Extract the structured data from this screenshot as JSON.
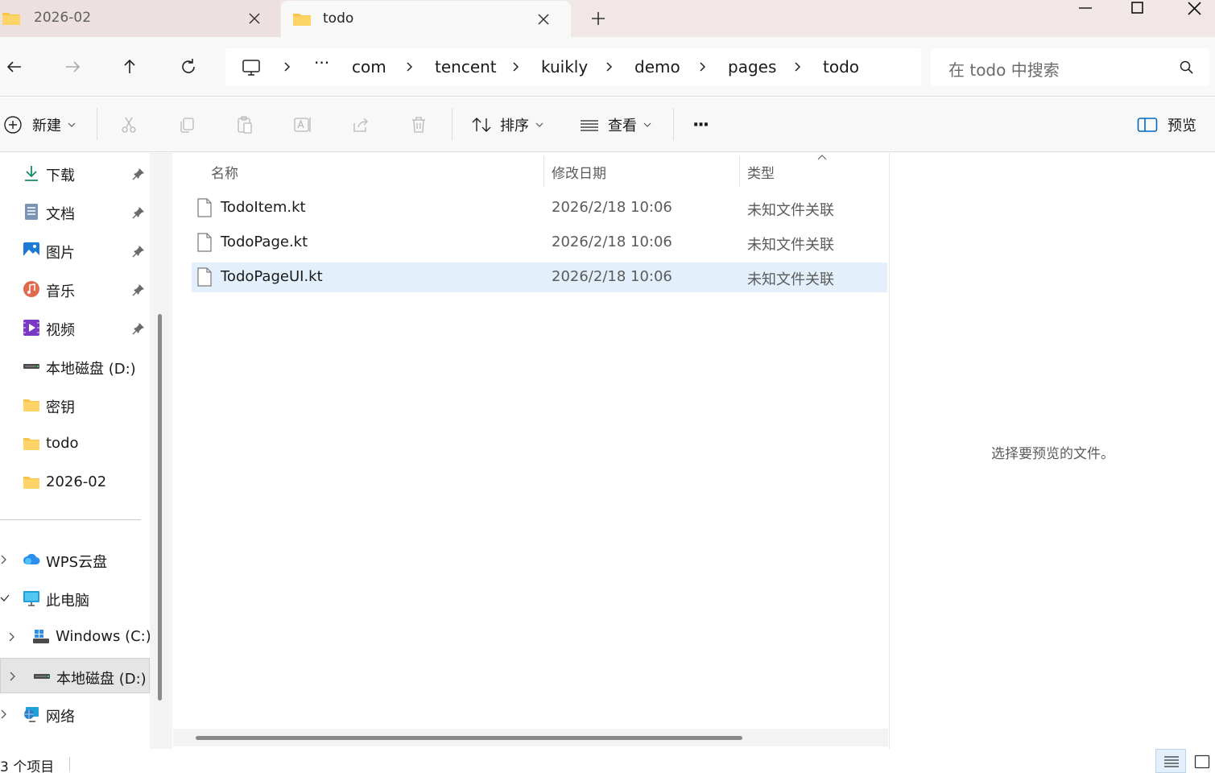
{
  "tabs": [
    {
      "label": "2026-02",
      "active": false
    },
    {
      "label": "todo",
      "active": true
    }
  ],
  "window_controls": {
    "minimize": "minimize-icon",
    "maximize": "maximize-icon",
    "close": "close-icon"
  },
  "breadcrumb": {
    "overflow": "···",
    "items": [
      "com",
      "tencent",
      "kuikly",
      "demo",
      "pages",
      "todo"
    ]
  },
  "search": {
    "placeholder": "在 todo 中搜索"
  },
  "toolbar": {
    "new_label": "新建",
    "sort_label": "排序",
    "view_label": "查看",
    "more_label": "···",
    "preview_label": "预览"
  },
  "sidebar": {
    "quick_access": [
      {
        "label": "下载",
        "icon": "download-icon",
        "pinned": true
      },
      {
        "label": "文档",
        "icon": "documents-icon",
        "pinned": true
      },
      {
        "label": "图片",
        "icon": "pictures-icon",
        "pinned": true
      },
      {
        "label": "音乐",
        "icon": "music-icon",
        "pinned": true
      },
      {
        "label": "视频",
        "icon": "videos-icon",
        "pinned": true
      },
      {
        "label": "本地磁盘 (D:)",
        "icon": "drive-icon",
        "pinned": false
      },
      {
        "label": "密钥",
        "icon": "folder-icon",
        "pinned": false
      },
      {
        "label": "todo",
        "icon": "folder-icon",
        "pinned": false
      },
      {
        "label": "2026-02",
        "icon": "folder-icon",
        "pinned": false
      }
    ],
    "tree": [
      {
        "label": "WPS云盘",
        "icon": "wps-cloud-icon",
        "chevron": "collapsed"
      },
      {
        "label": "此电脑",
        "icon": "this-pc-icon",
        "chevron": "expanded"
      },
      {
        "label": "Windows (C:)",
        "icon": "windows-drive-icon",
        "chevron": "collapsed"
      },
      {
        "label": "本地磁盘 (D:)",
        "icon": "drive-icon",
        "chevron": "collapsed",
        "selected": true
      },
      {
        "label": "网络",
        "icon": "network-icon",
        "chevron": "collapsed"
      }
    ]
  },
  "file_list": {
    "columns": [
      "名称",
      "修改日期",
      "类型"
    ],
    "rows": [
      {
        "name": "TodoItem.kt",
        "date": "2026/2/18 10:06",
        "type": "未知文件关联",
        "selected": false
      },
      {
        "name": "TodoPage.kt",
        "date": "2026/2/18 10:06",
        "type": "未知文件关联",
        "selected": false
      },
      {
        "name": "TodoPageUI.kt",
        "date": "2026/2/18 10:06",
        "type": "未知文件关联",
        "selected": true
      }
    ],
    "horizontal_scroll_fraction": 0.79
  },
  "preview_pane": {
    "message": "选择要预览的文件。"
  },
  "status": {
    "item_count": "3 个项目"
  },
  "colors": {
    "accent": "#0067c0",
    "selection": "#e3f0fc",
    "folder": "#f8c44a"
  }
}
